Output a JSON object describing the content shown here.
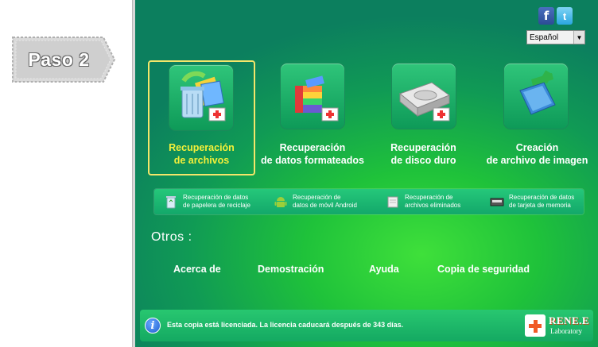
{
  "step": {
    "label": "Paso 2"
  },
  "language": {
    "selected": "Español"
  },
  "tiles": [
    {
      "line1": "Recuperación",
      "line2": "de archivos"
    },
    {
      "line1": "Recuperación",
      "line2": "de datos formateados"
    },
    {
      "line1": "Recuperación",
      "line2": "de disco duro"
    },
    {
      "line1": "Creación",
      "line2": "de archivo de imagen"
    }
  ],
  "sub_options": [
    {
      "line1": "Recuperación de datos",
      "line2": "de papelera de reciclaje",
      "icon": "recycle-bin-icon"
    },
    {
      "line1": "Recuperación de",
      "line2": "datos de móvil Android",
      "icon": "android-icon"
    },
    {
      "line1": "Recuperación de",
      "line2": "archivos eliminados",
      "icon": "deleted-file-icon"
    },
    {
      "line1": "Recuperación de datos",
      "line2": "de tarjeta de memoria",
      "icon": "memory-card-icon"
    }
  ],
  "others": {
    "label": "Otros :",
    "links": [
      "Acerca de",
      "Demostración",
      "Ayuda",
      "Copia de seguridad"
    ]
  },
  "license": {
    "text": "Esta copia está licenciada. La licencia caducará después de 343 días."
  },
  "brand": {
    "name": "RENE.E",
    "sub": "Laboratory"
  },
  "colors": {
    "selected_label": "#f4f03a",
    "selected_border": "#f4e66a",
    "accent": "#f05a28"
  }
}
